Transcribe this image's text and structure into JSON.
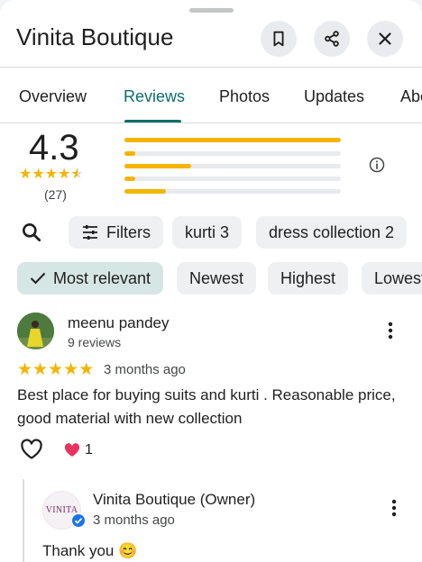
{
  "place": {
    "name": "Vinita Boutique"
  },
  "tabs": [
    "Overview",
    "Reviews",
    "Photos",
    "Updates",
    "About"
  ],
  "rating": {
    "value": "4.3",
    "count": "(27)",
    "star_fraction": 0.86,
    "distribution": [
      {
        "stars": 5,
        "fraction": 1.0
      },
      {
        "stars": 4,
        "fraction": 0.05
      },
      {
        "stars": 3,
        "fraction": 0.31
      },
      {
        "stars": 2,
        "fraction": 0.05
      },
      {
        "stars": 1,
        "fraction": 0.19
      }
    ]
  },
  "filters": {
    "filter_label": "Filters",
    "topics": [
      "kurti 3",
      "dress collection 2"
    ]
  },
  "sort": {
    "options": [
      "Most relevant",
      "Newest",
      "Highest",
      "Lowest"
    ],
    "selected": "Most relevant"
  },
  "review": {
    "author": "meenu pandey",
    "author_reviews": "9 reviews",
    "stars": 5,
    "date": "3 months ago",
    "text": "Best place for buying suits and kurti . Reasonable price, good material with new collection",
    "like_count": "1"
  },
  "owner_reply": {
    "name": "Vinita Boutique (Owner)",
    "logo_text": "VINITA",
    "date": "3 months ago",
    "text": "Thank you 😊"
  },
  "colors": {
    "accent": "#0b6f6a",
    "star": "#f4b400",
    "selected_chip": "#d6e6e4"
  }
}
